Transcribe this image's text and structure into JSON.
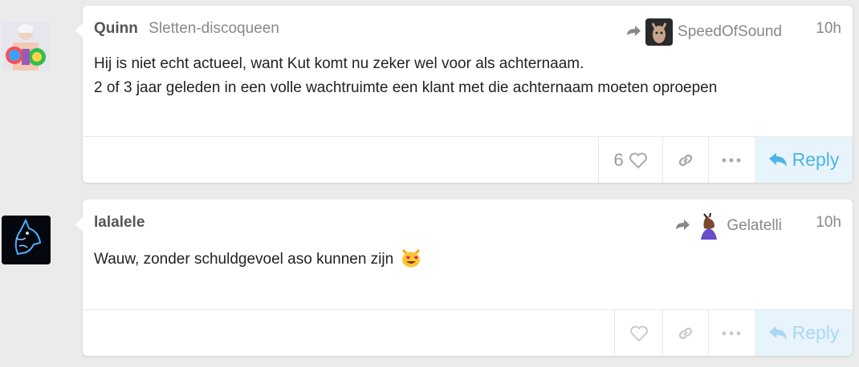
{
  "posts": [
    {
      "username": "Quinn",
      "user_title": "Sletten-discoqueen",
      "reply_to_user": "SpeedOfSound",
      "time": "10h",
      "lines": [
        "Hij is niet echt actueel, want Kut komt nu zeker wel voor als achternaam.",
        "2 of 3 jaar geleden in een volle wachtruimte een klant met die achternaam moeten oproepen"
      ],
      "like_count": "6",
      "reply_label": "Reply"
    },
    {
      "username": "lalalele",
      "user_title": "",
      "reply_to_user": "Gelatelli",
      "time": "10h",
      "lines": [
        "Wauw, zonder schuldgevoel aso kunnen zijn"
      ],
      "like_count": "",
      "reply_label": "Reply",
      "emoji": "heart-eyes-cat-icon"
    }
  ],
  "colors": {
    "reply_accent": "#4fb3e8",
    "reply_bg": "#e8f4fb",
    "meta_gray": "#888888"
  }
}
